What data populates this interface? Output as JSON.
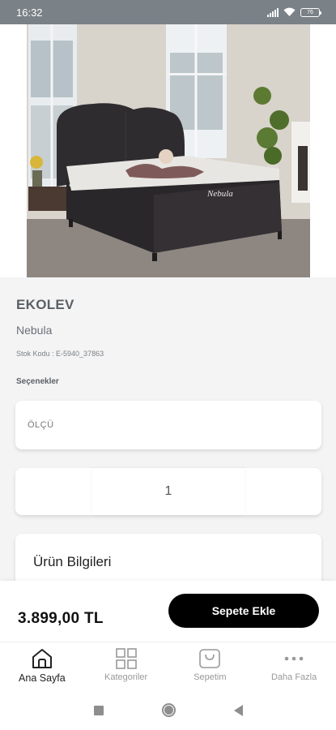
{
  "status_bar": {
    "time": "16:32",
    "battery": "76"
  },
  "product": {
    "image_icon": "bed-photo",
    "bed_label": "Nebula",
    "brand": "EKOLEV",
    "name": "Nebula",
    "sku": "Stok Kodu : E-5940_37863",
    "options_title": "Seçenekler",
    "size_placeholder": "ÖLÇÜ",
    "quantity": "1",
    "info_title": "Ürün Bilgileri"
  },
  "purchase": {
    "price": "3.899,00 TL",
    "add_to_cart_label": "Sepete Ekle"
  },
  "tabs": [
    {
      "label": "Ana Sayfa",
      "icon": "home-icon",
      "active": true
    },
    {
      "label": "Kategoriler",
      "icon": "grid-icon",
      "active": false
    },
    {
      "label": "Sepetim",
      "icon": "shopping-bag-icon",
      "active": false
    },
    {
      "label": "Daha Fazla",
      "icon": "more-icon",
      "active": false
    }
  ],
  "colors": {
    "button": "#000000",
    "status_bar": "#7a8187",
    "accent_text": "#5a6066"
  }
}
